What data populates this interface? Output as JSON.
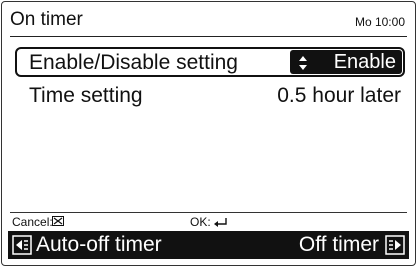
{
  "header": {
    "title": "On timer",
    "clock": "Mo 10:00"
  },
  "settings": {
    "enable": {
      "label": "Enable/Disable setting",
      "value": "Enable",
      "icon": "up-down-arrow-icon"
    },
    "time": {
      "label": "Time setting",
      "value": "0.5 hour later"
    }
  },
  "hints": {
    "cancel_label": "Cancel:",
    "cancel_icon": "cancel-button-icon",
    "ok_label": "OK:",
    "ok_icon": "enter-arrow-icon"
  },
  "footer": {
    "left_label": "Auto-off timer",
    "left_icon": "page-left-icon",
    "right_label": "Off timer",
    "right_icon": "page-right-icon"
  },
  "colors": {
    "background": "#ffffff",
    "selection": "#111111",
    "text": "#111111"
  }
}
